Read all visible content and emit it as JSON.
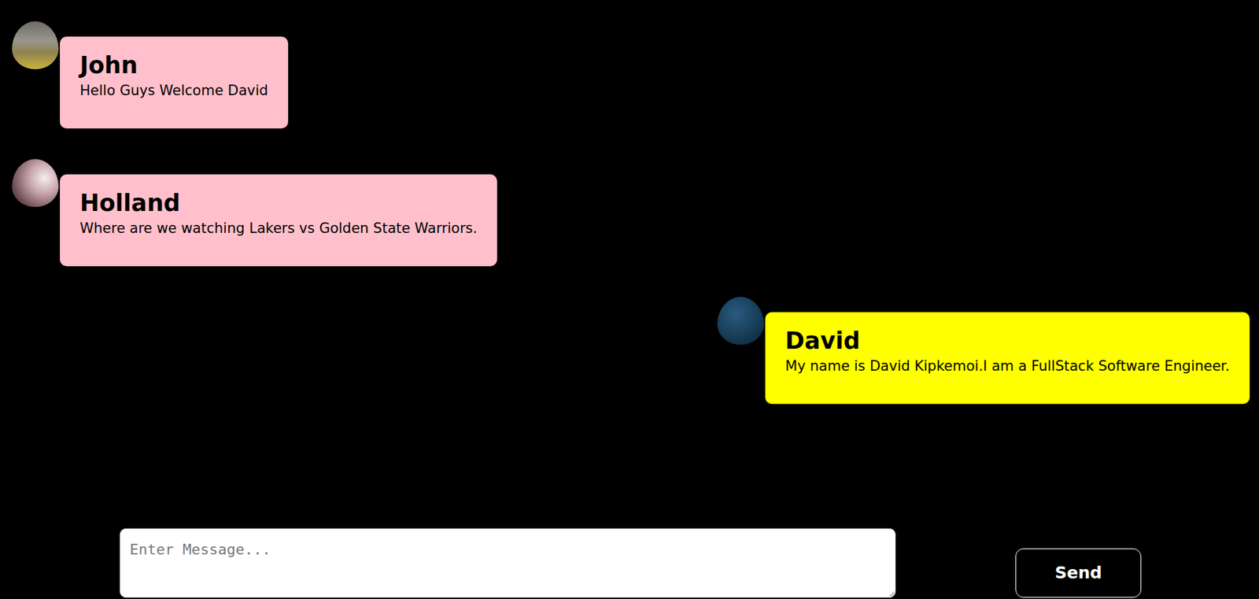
{
  "messages": [
    {
      "name": "John",
      "text": "Hello Guys Welcome David",
      "mine": false,
      "color": "#ffc0cb"
    },
    {
      "name": "Holland",
      "text": "Where are we watching Lakers vs Golden State Warriors.",
      "mine": false,
      "color": "#ffc0cb"
    },
    {
      "name": "David",
      "text": "My name is David Kipkemoi.I am a FullStack Software Engineer.",
      "mine": true,
      "color": "#ffff00"
    }
  ],
  "composer": {
    "placeholder": "Enter Message...",
    "send": "Send"
  }
}
